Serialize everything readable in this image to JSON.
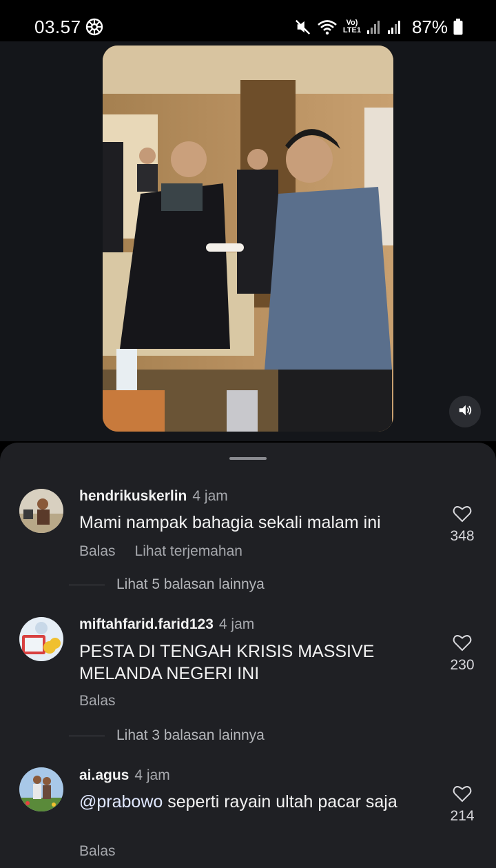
{
  "status_bar": {
    "time": "03.57",
    "battery_percent": "87%",
    "icons": [
      "gear-icon",
      "mute-icon",
      "wifi-icon",
      "volte-icon",
      "signal-icon",
      "battery-icon"
    ],
    "volte_label_top": "Vo)",
    "volte_label_bottom": "LTE1"
  },
  "video": {
    "volume_icon": "speaker-icon"
  },
  "comments": [
    {
      "username": "hendrikuskerlin",
      "time": "4 jam",
      "text": "Mami nampak bahagia sekali malam ini",
      "reply_label": "Balas",
      "translate_label": "Lihat terjemahan",
      "likes": "348",
      "more_replies": "Lihat 5 balasan lainnya"
    },
    {
      "username": "miftahfarid.farid123",
      "time": "4 jam",
      "text": "PESTA DI TENGAH KRISIS MASSIVE MELANDA NEGERI INI",
      "reply_label": "Balas",
      "likes": "230",
      "more_replies": "Lihat 3 balasan lainnya"
    },
    {
      "username": "ai.agus",
      "time": "4 jam",
      "mention": "@prabowo",
      "text": " seperti rayain ultah pacar saja",
      "reply_label": "Balas",
      "likes": "214"
    }
  ],
  "colors": {
    "sheet_background": "#1f2024",
    "secondary_text": "#a6a8ad",
    "primary_text": "#f2f2f2"
  }
}
